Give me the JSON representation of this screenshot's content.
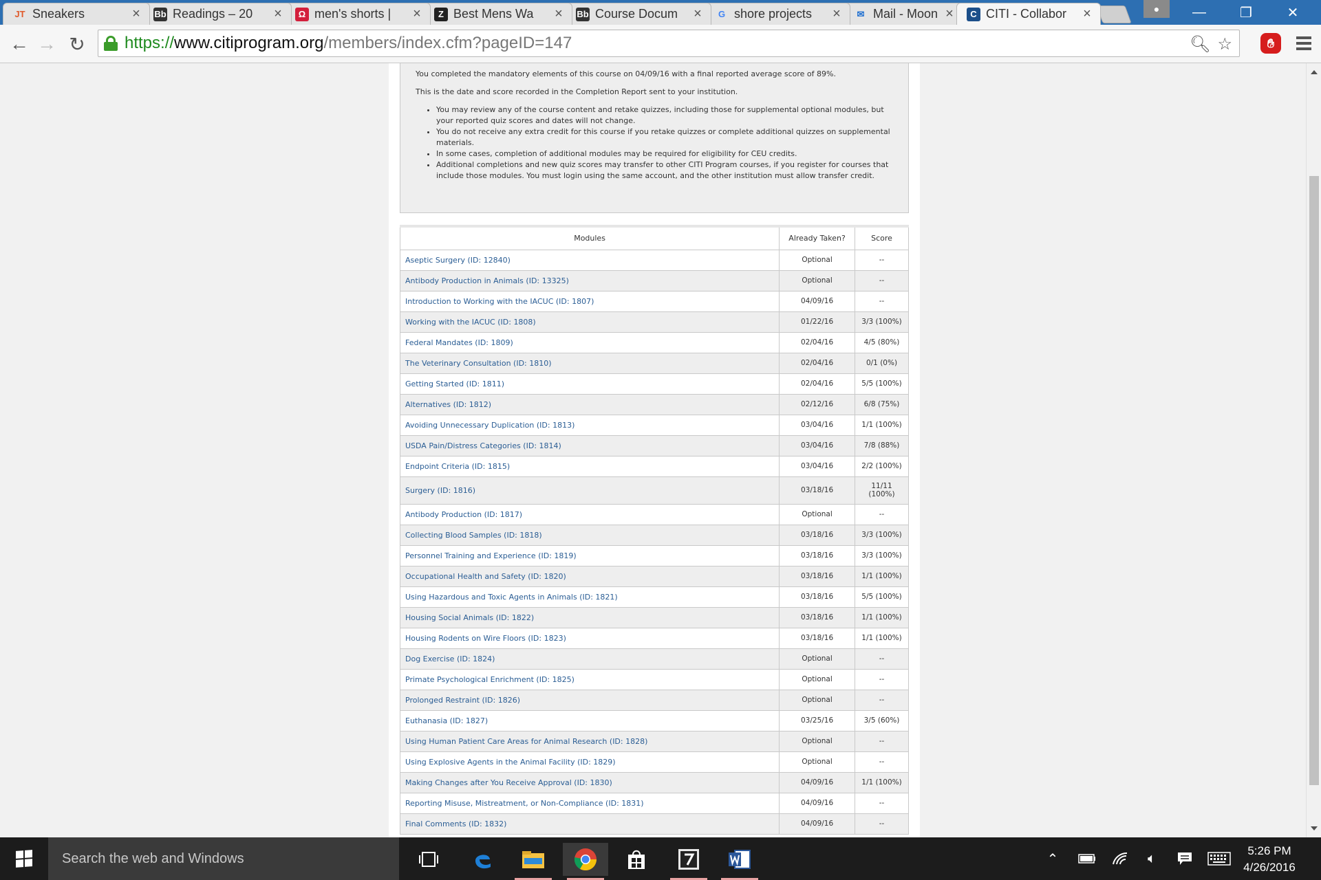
{
  "browser": {
    "tabs": [
      {
        "title": "Sneakers",
        "favicon": "JT",
        "favicon_color": "#e05a2b",
        "favicon_bg": "transparent",
        "active": false
      },
      {
        "title": "Readings – 20",
        "favicon": "Bb",
        "favicon_color": "#ffffff",
        "favicon_bg": "#333333",
        "active": false
      },
      {
        "title": "men's shorts |",
        "favicon": "Ω",
        "favicon_color": "#ffffff",
        "favicon_bg": "#d31f3c",
        "active": false
      },
      {
        "title": "Best Mens Wa",
        "favicon": "Z",
        "favicon_color": "#ffffff",
        "favicon_bg": "#222222",
        "active": false
      },
      {
        "title": "Course Docum",
        "favicon": "Bb",
        "favicon_color": "#ffffff",
        "favicon_bg": "#333333",
        "active": false
      },
      {
        "title": "shore projects",
        "favicon": "G",
        "favicon_color": "#4285f4",
        "favicon_bg": "transparent",
        "active": false
      },
      {
        "title": "Mail - Moon, J",
        "favicon": "✉",
        "favicon_color": "#1f6fd0",
        "favicon_bg": "transparent",
        "active": false
      },
      {
        "title": "CITI - Collabor",
        "favicon": "C",
        "favicon_color": "#ffffff",
        "favicon_bg": "#1c4f8a",
        "active": true
      }
    ],
    "tab_close": "×",
    "url": {
      "scheme": "https://",
      "host": "www.citiprogram.org",
      "path": "/members/index.cfm?pageID=147"
    },
    "window_controls": {
      "minimize": "—",
      "restore": "❐",
      "close": "✕"
    }
  },
  "notice": {
    "line1": "You completed the mandatory elements of this course on 04/09/16 with a final reported average score of 89%.",
    "line2": "This is the date and score recorded in the Completion Report sent to your institution.",
    "bullets": [
      "You may review any of the course content and retake quizzes, including those for supplemental optional modules, but your reported quiz scores and dates will not change.",
      "You do not receive any extra credit for this course if you retake quizzes or complete additional quizzes on supplemental materials.",
      "In some cases, completion of additional modules may be required for eligibility for CEU credits.",
      "Additional completions and new quiz scores may transfer to other CITI Program courses, if you register for courses that include those modules.  You must login using the same account, and the other institution must allow transfer credit."
    ]
  },
  "table": {
    "headers": {
      "module": "Modules",
      "taken": "Already Taken?",
      "score": "Score"
    },
    "rows": [
      {
        "module": "Aseptic Surgery (ID: 12840)",
        "taken": "Optional",
        "score": "--"
      },
      {
        "module": "Antibody Production in Animals (ID: 13325)",
        "taken": "Optional",
        "score": "--"
      },
      {
        "module": "Introduction to Working with the IACUC (ID: 1807)",
        "taken": "04/09/16",
        "score": "--"
      },
      {
        "module": "Working with the IACUC (ID: 1808)",
        "taken": "01/22/16",
        "score": "3/3 (100%)"
      },
      {
        "module": "Federal Mandates (ID: 1809)",
        "taken": "02/04/16",
        "score": "4/5 (80%)"
      },
      {
        "module": "The Veterinary Consultation (ID: 1810)",
        "taken": "02/04/16",
        "score": "0/1 (0%)"
      },
      {
        "module": "Getting Started (ID: 1811)",
        "taken": "02/04/16",
        "score": "5/5 (100%)"
      },
      {
        "module": "Alternatives (ID: 1812)",
        "taken": "02/12/16",
        "score": "6/8 (75%)"
      },
      {
        "module": "Avoiding Unnecessary Duplication (ID: 1813)",
        "taken": "03/04/16",
        "score": "1/1 (100%)"
      },
      {
        "module": "USDA Pain/Distress Categories (ID: 1814)",
        "taken": "03/04/16",
        "score": "7/8 (88%)"
      },
      {
        "module": "Endpoint Criteria (ID: 1815)",
        "taken": "03/04/16",
        "score": "2/2 (100%)"
      },
      {
        "module": "Surgery (ID: 1816)",
        "taken": "03/18/16",
        "score": "11/11 (100%)"
      },
      {
        "module": "Antibody Production (ID: 1817)",
        "taken": "Optional",
        "score": "--"
      },
      {
        "module": "Collecting Blood Samples (ID: 1818)",
        "taken": "03/18/16",
        "score": "3/3 (100%)"
      },
      {
        "module": "Personnel Training and Experience (ID: 1819)",
        "taken": "03/18/16",
        "score": "3/3 (100%)"
      },
      {
        "module": "Occupational Health and Safety (ID: 1820)",
        "taken": "03/18/16",
        "score": "1/1 (100%)"
      },
      {
        "module": "Using Hazardous and Toxic Agents in Animals (ID: 1821)",
        "taken": "03/18/16",
        "score": "5/5 (100%)"
      },
      {
        "module": "Housing Social Animals (ID: 1822)",
        "taken": "03/18/16",
        "score": "1/1 (100%)"
      },
      {
        "module": "Housing Rodents on Wire Floors (ID: 1823)",
        "taken": "03/18/16",
        "score": "1/1 (100%)"
      },
      {
        "module": "Dog Exercise (ID: 1824)",
        "taken": "Optional",
        "score": "--"
      },
      {
        "module": "Primate Psychological Enrichment (ID: 1825)",
        "taken": "Optional",
        "score": "--"
      },
      {
        "module": "Prolonged Restraint (ID: 1826)",
        "taken": "Optional",
        "score": "--"
      },
      {
        "module": "Euthanasia (ID: 1827)",
        "taken": "03/25/16",
        "score": "3/5 (60%)"
      },
      {
        "module": "Using Human Patient Care Areas for Animal Research (ID: 1828)",
        "taken": "Optional",
        "score": "--"
      },
      {
        "module": "Using Explosive Agents in the Animal Facility (ID: 1829)",
        "taken": "Optional",
        "score": "--"
      },
      {
        "module": "Making Changes after You Receive Approval (ID: 1830)",
        "taken": "04/09/16",
        "score": "1/1 (100%)"
      },
      {
        "module": "Reporting Misuse, Mistreatment, or Non-Compliance (ID: 1831)",
        "taken": "04/09/16",
        "score": "--"
      },
      {
        "module": "Final Comments (ID: 1832)",
        "taken": "04/09/16",
        "score": "--"
      }
    ]
  },
  "taskbar": {
    "search_placeholder": "Search the web and Windows",
    "time": "5:26 PM",
    "date": "4/26/2016"
  }
}
